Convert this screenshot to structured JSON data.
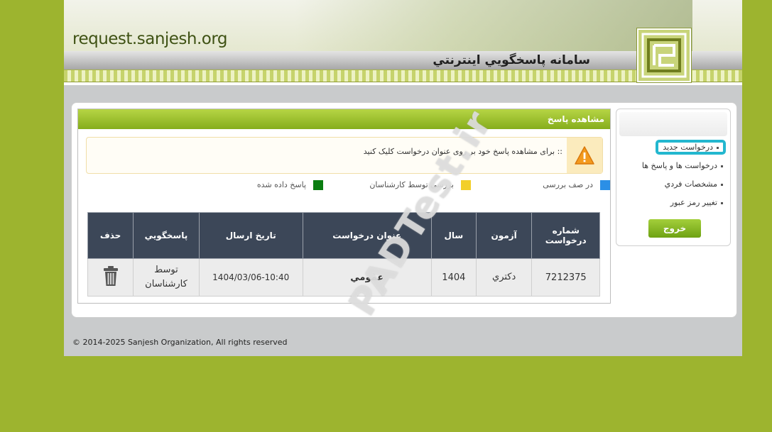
{
  "header": {
    "site_url": "request.sanjesh.org",
    "site_title": "سامانه پاسخگويي اينترنتي"
  },
  "sidebar": {
    "items": [
      {
        "label": "درخواست جديد",
        "active": true
      },
      {
        "label": "درخواست ها و پاسخ ها"
      },
      {
        "label": "مشخصات فردي"
      },
      {
        "label": "تغيير رمز عبور"
      }
    ],
    "logout_label": "خروج"
  },
  "main": {
    "panel_title": "مشاهده پاسخ",
    "alert_text": ":: برای مشاهده پاسخ خود بر روی عنوان درخواست کلیک کنید",
    "legend": [
      {
        "label": "در صف بررسی",
        "color": "#2b8fe6"
      },
      {
        "label": "بررسی توسط کارشناسان",
        "color": "#f2cf2a"
      },
      {
        "label": "پاسخ داده شده",
        "color": "#0a7d10"
      }
    ],
    "table": {
      "headers": [
        "شماره درخواست",
        "آزمون",
        "سال",
        "عنوان درخواست",
        "تاريخ ارسال",
        "پاسخگويي",
        "حذف"
      ],
      "rows": [
        {
          "number": "7212375",
          "exam": "دكتري",
          "year": "1404",
          "subject": "عمومي",
          "date": "1404/03/06-10:40",
          "answer_line1": "توسط",
          "answer_line2": "كارشناسان"
        }
      ]
    }
  },
  "watermark": "PADTest.ir",
  "footer": {
    "copyright": "© 2014-2025 Sanjesh Organization, All rights reserved"
  },
  "icons": {
    "alert": "warning-icon",
    "delete": "trash-icon"
  }
}
